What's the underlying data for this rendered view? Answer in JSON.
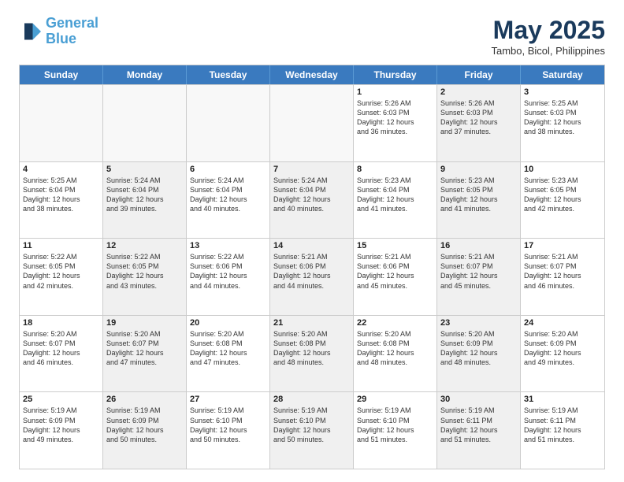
{
  "logo": {
    "line1": "General",
    "line2": "Blue"
  },
  "title": "May 2025",
  "location": "Tambo, Bicol, Philippines",
  "days_of_week": [
    "Sunday",
    "Monday",
    "Tuesday",
    "Wednesday",
    "Thursday",
    "Friday",
    "Saturday"
  ],
  "weeks": [
    [
      {
        "day": "",
        "text": "",
        "shaded": true,
        "empty": true
      },
      {
        "day": "",
        "text": "",
        "shaded": true,
        "empty": true
      },
      {
        "day": "",
        "text": "",
        "shaded": true,
        "empty": true
      },
      {
        "day": "",
        "text": "",
        "shaded": true,
        "empty": true
      },
      {
        "day": "1",
        "text": "Sunrise: 5:26 AM\nSunset: 6:03 PM\nDaylight: 12 hours\nand 36 minutes."
      },
      {
        "day": "2",
        "text": "Sunrise: 5:26 AM\nSunset: 6:03 PM\nDaylight: 12 hours\nand 37 minutes.",
        "shaded": true
      },
      {
        "day": "3",
        "text": "Sunrise: 5:25 AM\nSunset: 6:03 PM\nDaylight: 12 hours\nand 38 minutes."
      }
    ],
    [
      {
        "day": "4",
        "text": "Sunrise: 5:25 AM\nSunset: 6:04 PM\nDaylight: 12 hours\nand 38 minutes."
      },
      {
        "day": "5",
        "text": "Sunrise: 5:24 AM\nSunset: 6:04 PM\nDaylight: 12 hours\nand 39 minutes.",
        "shaded": true
      },
      {
        "day": "6",
        "text": "Sunrise: 5:24 AM\nSunset: 6:04 PM\nDaylight: 12 hours\nand 40 minutes."
      },
      {
        "day": "7",
        "text": "Sunrise: 5:24 AM\nSunset: 6:04 PM\nDaylight: 12 hours\nand 40 minutes.",
        "shaded": true
      },
      {
        "day": "8",
        "text": "Sunrise: 5:23 AM\nSunset: 6:04 PM\nDaylight: 12 hours\nand 41 minutes."
      },
      {
        "day": "9",
        "text": "Sunrise: 5:23 AM\nSunset: 6:05 PM\nDaylight: 12 hours\nand 41 minutes.",
        "shaded": true
      },
      {
        "day": "10",
        "text": "Sunrise: 5:23 AM\nSunset: 6:05 PM\nDaylight: 12 hours\nand 42 minutes."
      }
    ],
    [
      {
        "day": "11",
        "text": "Sunrise: 5:22 AM\nSunset: 6:05 PM\nDaylight: 12 hours\nand 42 minutes."
      },
      {
        "day": "12",
        "text": "Sunrise: 5:22 AM\nSunset: 6:05 PM\nDaylight: 12 hours\nand 43 minutes.",
        "shaded": true
      },
      {
        "day": "13",
        "text": "Sunrise: 5:22 AM\nSunset: 6:06 PM\nDaylight: 12 hours\nand 44 minutes."
      },
      {
        "day": "14",
        "text": "Sunrise: 5:21 AM\nSunset: 6:06 PM\nDaylight: 12 hours\nand 44 minutes.",
        "shaded": true
      },
      {
        "day": "15",
        "text": "Sunrise: 5:21 AM\nSunset: 6:06 PM\nDaylight: 12 hours\nand 45 minutes."
      },
      {
        "day": "16",
        "text": "Sunrise: 5:21 AM\nSunset: 6:07 PM\nDaylight: 12 hours\nand 45 minutes.",
        "shaded": true
      },
      {
        "day": "17",
        "text": "Sunrise: 5:21 AM\nSunset: 6:07 PM\nDaylight: 12 hours\nand 46 minutes."
      }
    ],
    [
      {
        "day": "18",
        "text": "Sunrise: 5:20 AM\nSunset: 6:07 PM\nDaylight: 12 hours\nand 46 minutes."
      },
      {
        "day": "19",
        "text": "Sunrise: 5:20 AM\nSunset: 6:07 PM\nDaylight: 12 hours\nand 47 minutes.",
        "shaded": true
      },
      {
        "day": "20",
        "text": "Sunrise: 5:20 AM\nSunset: 6:08 PM\nDaylight: 12 hours\nand 47 minutes."
      },
      {
        "day": "21",
        "text": "Sunrise: 5:20 AM\nSunset: 6:08 PM\nDaylight: 12 hours\nand 48 minutes.",
        "shaded": true
      },
      {
        "day": "22",
        "text": "Sunrise: 5:20 AM\nSunset: 6:08 PM\nDaylight: 12 hours\nand 48 minutes."
      },
      {
        "day": "23",
        "text": "Sunrise: 5:20 AM\nSunset: 6:09 PM\nDaylight: 12 hours\nand 48 minutes.",
        "shaded": true
      },
      {
        "day": "24",
        "text": "Sunrise: 5:20 AM\nSunset: 6:09 PM\nDaylight: 12 hours\nand 49 minutes."
      }
    ],
    [
      {
        "day": "25",
        "text": "Sunrise: 5:19 AM\nSunset: 6:09 PM\nDaylight: 12 hours\nand 49 minutes."
      },
      {
        "day": "26",
        "text": "Sunrise: 5:19 AM\nSunset: 6:09 PM\nDaylight: 12 hours\nand 50 minutes.",
        "shaded": true
      },
      {
        "day": "27",
        "text": "Sunrise: 5:19 AM\nSunset: 6:10 PM\nDaylight: 12 hours\nand 50 minutes."
      },
      {
        "day": "28",
        "text": "Sunrise: 5:19 AM\nSunset: 6:10 PM\nDaylight: 12 hours\nand 50 minutes.",
        "shaded": true
      },
      {
        "day": "29",
        "text": "Sunrise: 5:19 AM\nSunset: 6:10 PM\nDaylight: 12 hours\nand 51 minutes."
      },
      {
        "day": "30",
        "text": "Sunrise: 5:19 AM\nSunset: 6:11 PM\nDaylight: 12 hours\nand 51 minutes.",
        "shaded": true
      },
      {
        "day": "31",
        "text": "Sunrise: 5:19 AM\nSunset: 6:11 PM\nDaylight: 12 hours\nand 51 minutes."
      }
    ]
  ]
}
